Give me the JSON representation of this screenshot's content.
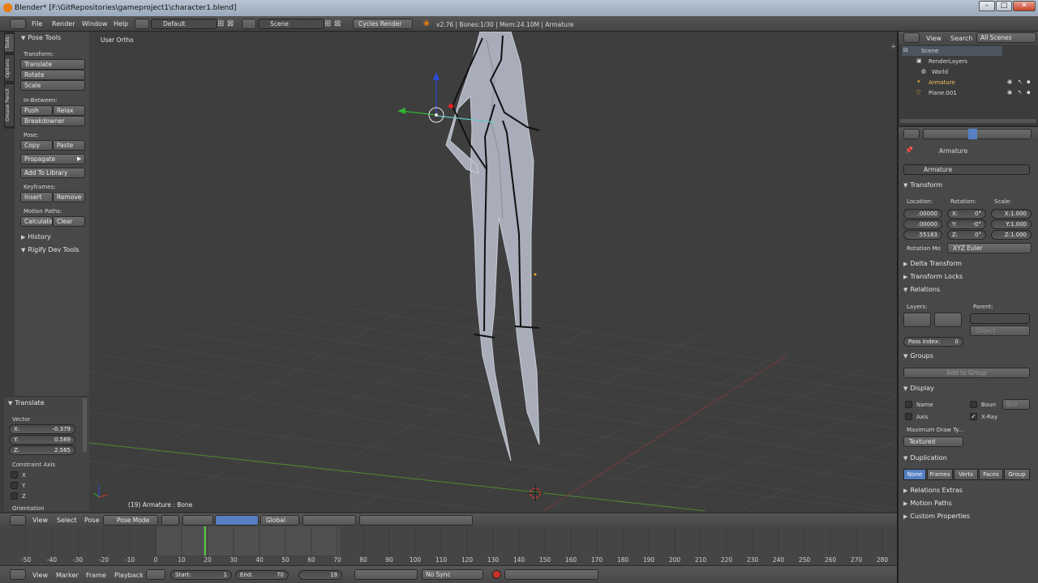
{
  "window": {
    "title": "Blender* [F:\\GitRepositories\\gameproject1\\character1.blend]",
    "min": "–",
    "max": "□",
    "close": "✕"
  },
  "info": {
    "menus": [
      "File",
      "Render",
      "Window",
      "Help"
    ],
    "layout": "Default",
    "scene": "Scene",
    "engine": "Cycles Render",
    "stats": "v2.76 | Bones:1/30 | Mem:24.10M | Armature"
  },
  "tool_tabs": [
    "Tools",
    "Options",
    "Grease Pencil"
  ],
  "tool_shelf": {
    "panel_title": "Pose Tools",
    "transform_label": "Transform:",
    "translate": "Translate",
    "rotate": "Rotate",
    "scale": "Scale",
    "inbetween_label": "In-Between:",
    "push": "Push",
    "relax": "Relax",
    "breakdowner": "Breakdowner",
    "pose_label": "Pose:",
    "copy": "Copy",
    "paste": "Paste",
    "propagate": "Propagate",
    "add_library": "Add To Library",
    "keyframes_label": "Keyframes:",
    "insert": "Insert",
    "remove": "Remove",
    "motion_label": "Motion Paths:",
    "calculate": "Calculate",
    "clear": "Clear",
    "history": "History",
    "rigify": "Rigify Dev Tools"
  },
  "operator": {
    "title": "Translate",
    "vector_label": "Vector",
    "x_label": "X:",
    "x_value": "-0.379",
    "y_label": "Y:",
    "y_value": "0.589",
    "z_label": "Z:",
    "z_value": "2.565",
    "constraint_label": "Constraint Axis",
    "axes": [
      "X",
      "Y",
      "Z"
    ],
    "orientation_label": "Orientation"
  },
  "viewport": {
    "view_name": "User Ortho",
    "status": "(19) Armature : Bone"
  },
  "viewport_header": {
    "view": "View",
    "select": "Select",
    "pose": "Pose",
    "mode": "Pose Mode",
    "orientation": "Global"
  },
  "timeline": {
    "ticks": [
      "-50",
      "-40",
      "-30",
      "-20",
      "-10",
      "0",
      "10",
      "20",
      "30",
      "40",
      "50",
      "60",
      "70",
      "80",
      "90",
      "100",
      "110",
      "120",
      "130",
      "140",
      "150",
      "160",
      "170",
      "180",
      "190",
      "200",
      "210",
      "220",
      "230",
      "240",
      "250",
      "260",
      "270",
      "280"
    ],
    "current_frame": 19
  },
  "timeline_header": {
    "view": "View",
    "marker": "Marker",
    "frame": "Frame",
    "playback": "Playback",
    "start_label": "Start:",
    "start_value": "1",
    "end_label": "End:",
    "end_value": "70",
    "current": "19",
    "sync": "No Sync"
  },
  "outliner": {
    "view": "View",
    "search": "Search",
    "filter": "All Scenes",
    "items": [
      {
        "label": "Scene"
      },
      {
        "label": "RenderLayers"
      },
      {
        "label": "World"
      },
      {
        "label": "Armature"
      },
      {
        "label": "Plane.001"
      }
    ]
  },
  "properties": {
    "breadcrumb": "Armature",
    "object_name": "Armature",
    "transform": "Transform",
    "location_label": "Location:",
    "rotation_label": "Rotation:",
    "scale_label": "Scale:",
    "loc": [
      ".00000",
      ".00000",
      ".55183"
    ],
    "rot_x": "X:",
    "rot_x_val": "0°",
    "rot_y": "Y:",
    "rot_y_val": "-0°",
    "rot_z": "Z:",
    "rot_z_val": "0°",
    "scale_x": "X:1.000",
    "scale_y": "Y:1.000",
    "scale_z": "Z:1.000",
    "rotation_mode_label": "Rotation Mo",
    "rotation_mode": "XYZ Euler",
    "delta_transform": "Delta Transform",
    "transform_locks": "Transform Locks",
    "relations": "Relations",
    "layers_label": "Layers:",
    "parent_label": "Parent:",
    "parent_type": "Object",
    "pass_index_label": "Pass Index:",
    "pass_index": "0",
    "groups": "Groups",
    "add_to_group": "Add to Group",
    "display": "Display",
    "name_label": "Name",
    "bounds_label": "Boun",
    "bounds_type": "Box",
    "axis_label": "Axis",
    "xray_label": "X-Ray",
    "max_draw_label": "Maximum Draw Ty...",
    "max_draw": "Textured",
    "duplication": "Duplication",
    "dup_tabs": [
      "None",
      "Frames",
      "Verts",
      "Faces",
      "Group"
    ],
    "relations_extras": "Relations Extras",
    "motion_paths": "Motion Paths",
    "custom_properties": "Custom Properties"
  },
  "colors": {
    "accent": "#5680c2",
    "title_bar": "#9aa9bb",
    "bone": "#111111",
    "mesh": "#b8bcc8",
    "x_axis": "#8a3b3b",
    "y_axis": "#4f8a2e"
  }
}
